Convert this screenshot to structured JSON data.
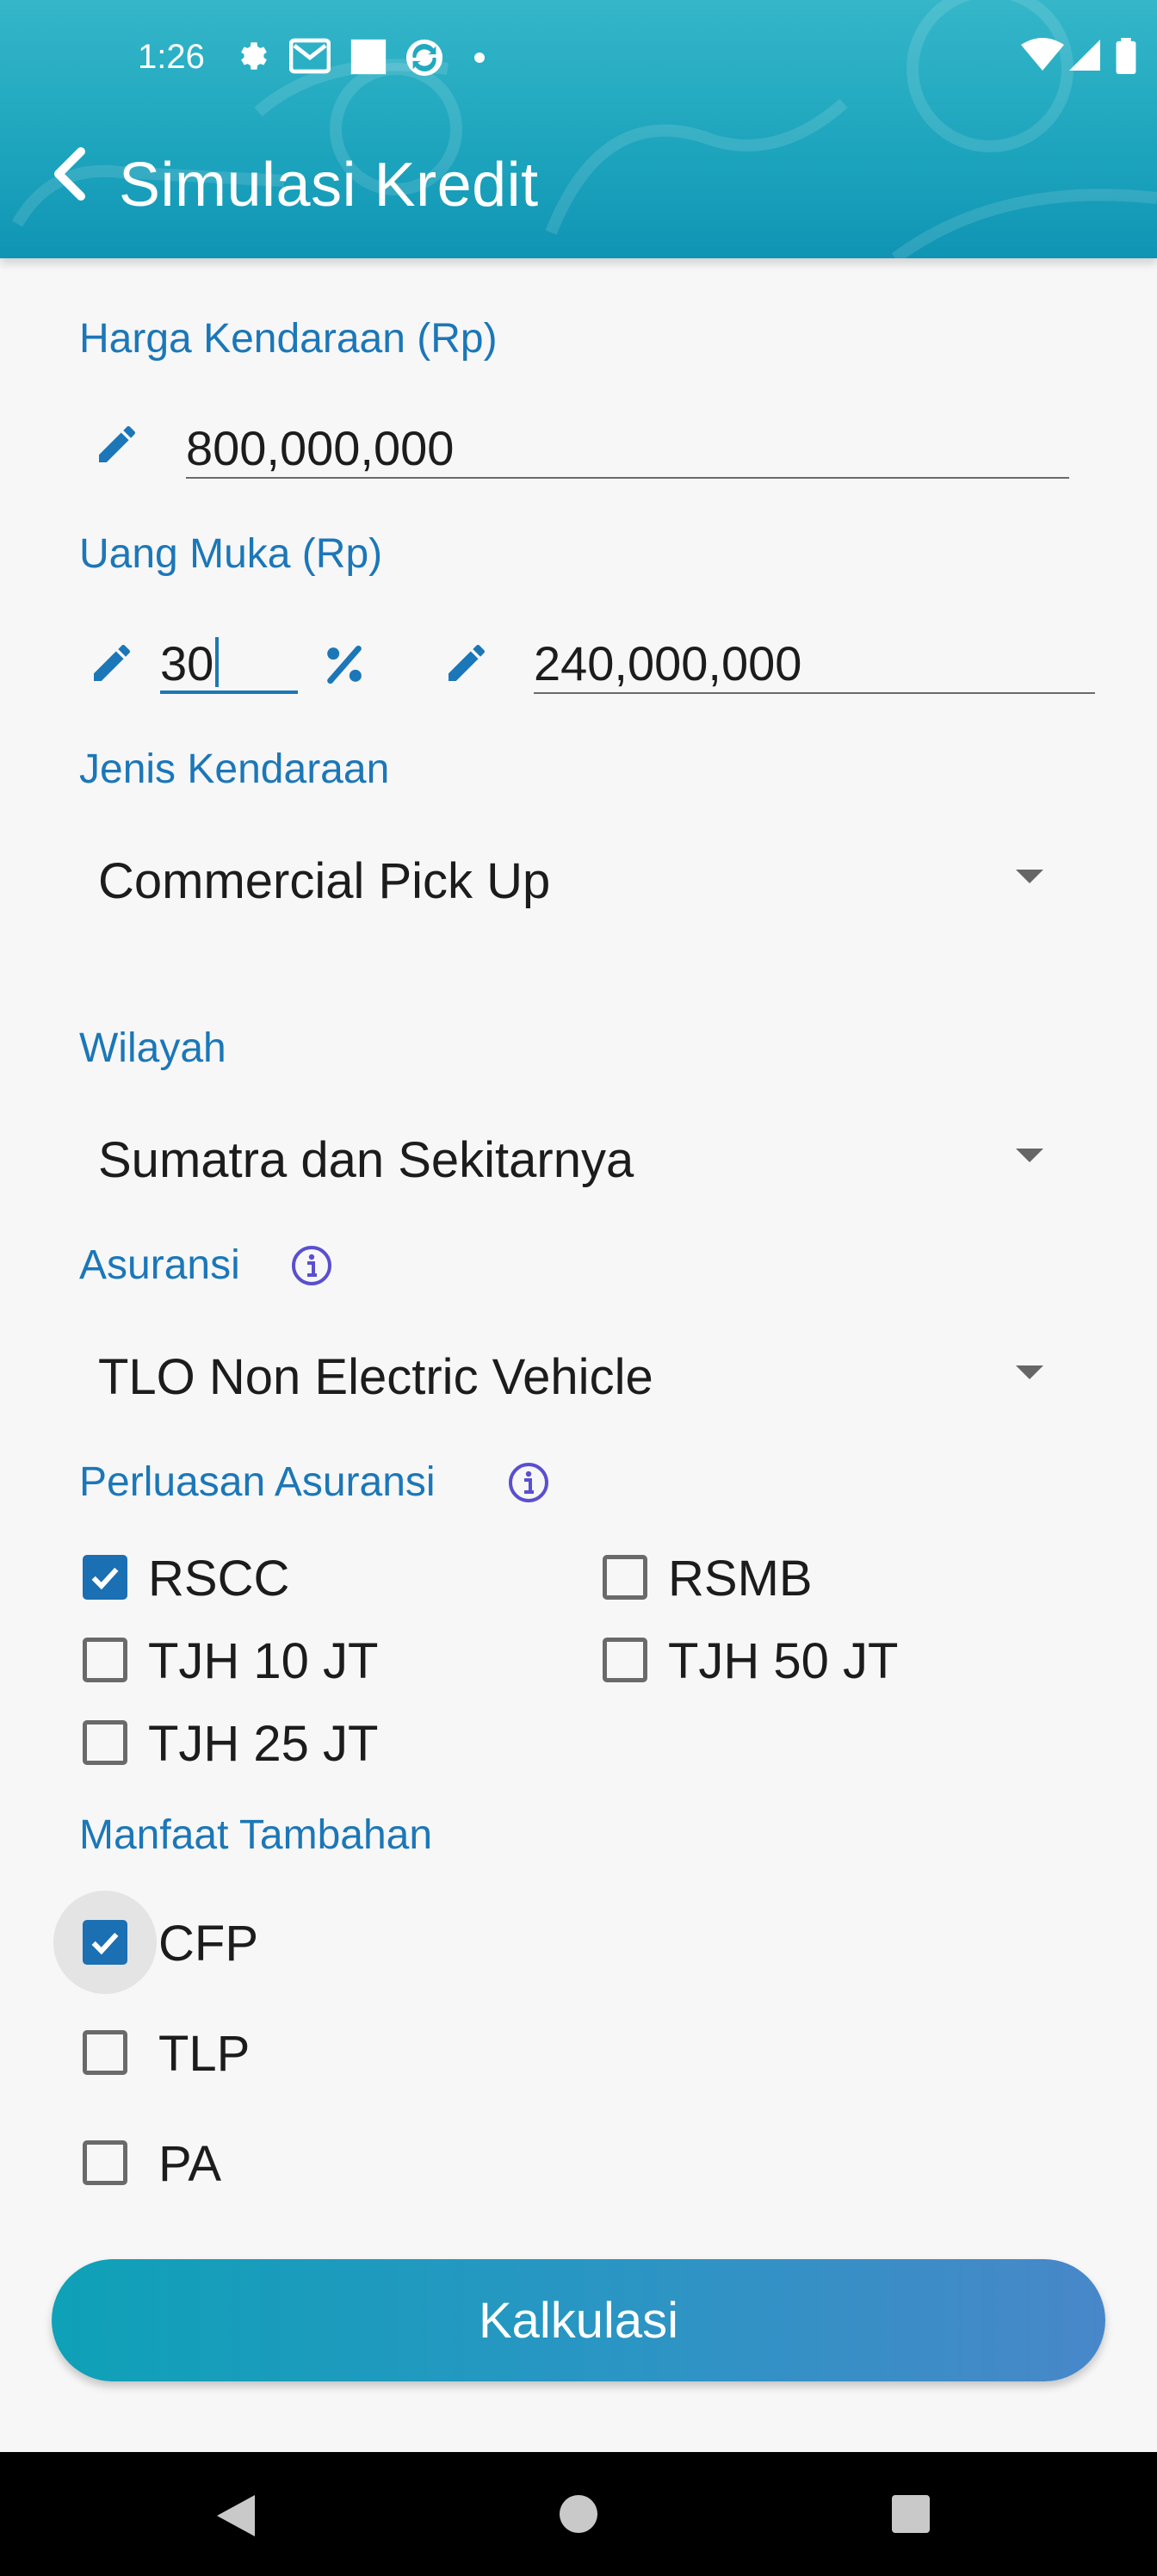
{
  "status_bar": {
    "time": "1:26",
    "icons": [
      "gear-icon",
      "gmail-icon",
      "square-icon",
      "sync-icon",
      "dot-icon",
      "wifi-icon",
      "signal-icon",
      "battery-icon"
    ]
  },
  "header": {
    "title": "Simulasi Kredit",
    "back_icon": "chevron-left-icon"
  },
  "form": {
    "harga": {
      "label": "Harga Kendaraan (Rp)",
      "value": "800,000,000"
    },
    "uang_muka": {
      "label": "Uang Muka (Rp)",
      "percent_value": "30",
      "amount_value": "240,000,000"
    },
    "jenis": {
      "label": "Jenis Kendaraan",
      "selected": "Commercial Pick Up"
    },
    "wilayah": {
      "label": "Wilayah",
      "selected": "Sumatra dan Sekitarnya"
    },
    "asuransi": {
      "label": "Asuransi",
      "selected": "TLO Non Electric Vehicle"
    },
    "perluasan": {
      "label": "Perluasan Asuransi",
      "options": [
        {
          "label": "RSCC",
          "checked": true
        },
        {
          "label": "RSMB",
          "checked": false
        },
        {
          "label": "TJH 10 JT",
          "checked": false
        },
        {
          "label": "TJH 50 JT",
          "checked": false
        },
        {
          "label": "TJH 25 JT",
          "checked": false
        }
      ]
    },
    "manfaat": {
      "label": "Manfaat Tambahan",
      "options": [
        {
          "label": "CFP",
          "checked": true
        },
        {
          "label": "TLP",
          "checked": false
        },
        {
          "label": "PA",
          "checked": false
        }
      ]
    }
  },
  "button": {
    "label": "Kalkulasi"
  },
  "colors": {
    "accent": "#1b77b8",
    "header": "#22a9c0",
    "checkbox_checked": "#1b6fb3"
  }
}
